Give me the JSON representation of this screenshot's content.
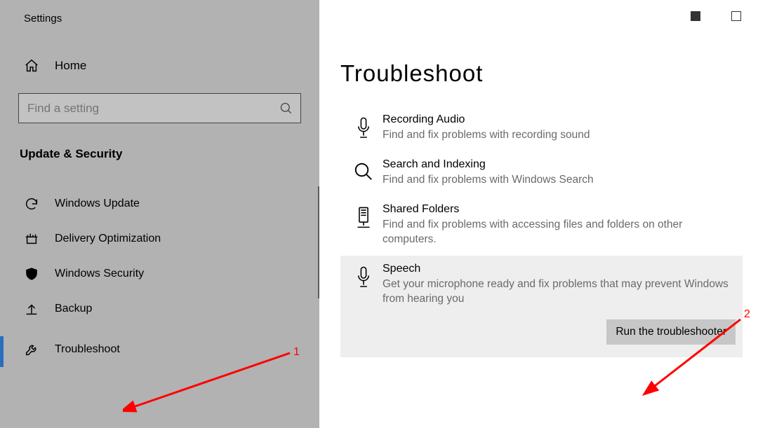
{
  "app_title": "Settings",
  "home_label": "Home",
  "search_placeholder": "Find a setting",
  "section_header": "Update & Security",
  "nav": {
    "items": [
      {
        "label": "Windows Update"
      },
      {
        "label": "Delivery Optimization"
      },
      {
        "label": "Windows Security"
      },
      {
        "label": "Backup"
      },
      {
        "label": "Troubleshoot"
      }
    ]
  },
  "main": {
    "title": "Troubleshoot",
    "items": [
      {
        "title": "Recording Audio",
        "desc": "Find and fix problems with recording sound"
      },
      {
        "title": "Search and Indexing",
        "desc": "Find and fix problems with Windows Search"
      },
      {
        "title": "Shared Folders",
        "desc": "Find and fix problems with accessing files and folders on other computers."
      },
      {
        "title": "Speech",
        "desc": "Get your microphone ready and fix problems that may prevent Windows from hearing you"
      }
    ],
    "run_button": "Run the troubleshooter"
  },
  "annotations": {
    "a1": "1",
    "a2": "2"
  }
}
